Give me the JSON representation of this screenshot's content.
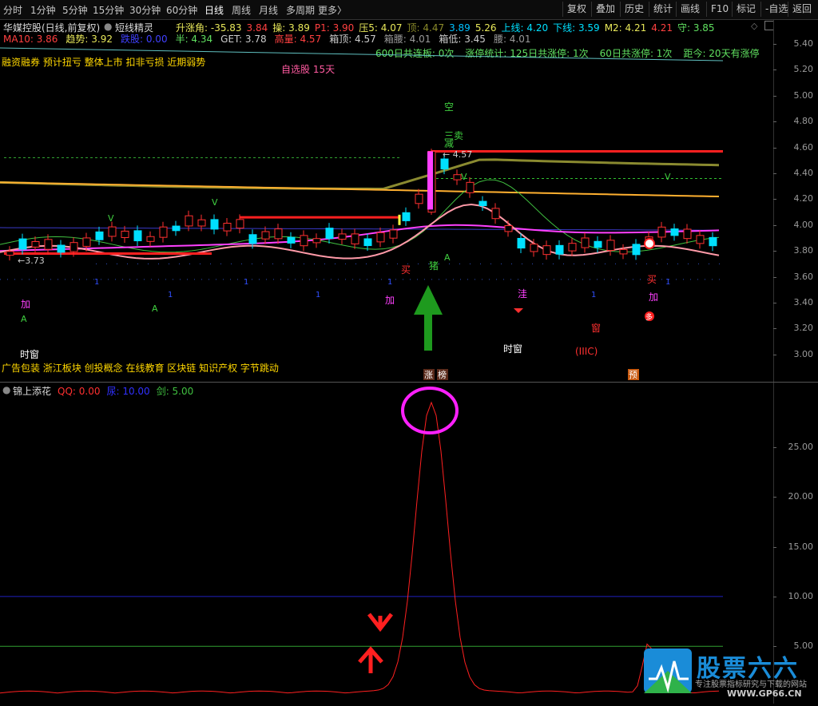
{
  "toolbar": {
    "periods": [
      "分时",
      "1分钟",
      "5分钟",
      "15分钟",
      "30分钟",
      "60分钟",
      "日线",
      "周线",
      "月线",
      "多周期",
      "更多〉"
    ],
    "active": "日线",
    "actions": [
      "复权",
      "叠加",
      "历史",
      "统计",
      "画线",
      "F10",
      "标记",
      "-自选",
      "返回"
    ]
  },
  "main": {
    "stock_title": "华媒控股(日线,前复权)",
    "indicator": "短线精灵",
    "row1": [
      {
        "t": "升涨角: -35.83",
        "c": "#e8e85a"
      },
      {
        "t": "3.84",
        "c": "#ff4040"
      },
      {
        "t": "操: 3.89",
        "c": "#e8e85a"
      },
      {
        "t": "P1: 3.90",
        "c": "#ff4040"
      },
      {
        "t": "压5: 4.07",
        "c": "#e8e85a"
      },
      {
        "t": "顶: 4.47",
        "c": "#8a8a2a"
      },
      {
        "t": "3.89",
        "c": "#00c0ff"
      },
      {
        "t": "5.26",
        "c": "#e8e85a"
      },
      {
        "t": "上线: 4.20",
        "c": "#00e0ff"
      },
      {
        "t": "下线: 3.59",
        "c": "#00e0ff"
      },
      {
        "t": "M2: 4.21",
        "c": "#e8e85a"
      },
      {
        "t": "4.21",
        "c": "#ff4040"
      },
      {
        "t": "守: 3.85",
        "c": "#60e060"
      }
    ],
    "row2": [
      {
        "t": "MA10: 3.86",
        "c": "#ff4040"
      },
      {
        "t": "趋势: 3.92",
        "c": "#e8e85a"
      },
      {
        "t": "跌股: 0.00",
        "c": "#4040ff"
      },
      {
        "t": "半: 4.34",
        "c": "#60e060"
      },
      {
        "t": "GET: 3.78",
        "c": "#cccccc"
      },
      {
        "t": "高量: 4.57",
        "c": "#ff4040"
      },
      {
        "t": "箱顶: 4.57",
        "c": "#cccccc"
      },
      {
        "t": "箱腰: 4.01",
        "c": "#9a9a9a"
      },
      {
        "t": "箱低: 3.45",
        "c": "#cccccc"
      },
      {
        "t": "腰: 4.01",
        "c": "#9a9a9a"
      }
    ],
    "row3": [
      {
        "t": "600日共连板: 0次",
        "c": "#60e060"
      },
      {
        "t": "涨停统计: 125日共涨停: 1次",
        "c": "#60e060"
      },
      {
        "t": "60日共涨停: 1次",
        "c": "#60e060"
      },
      {
        "t": "距今: 20天有涨停",
        "c": "#60e060"
      }
    ],
    "concepts": "融资融券 预计扭亏 整体上市 扣非亏损 近期弱势",
    "self_select": "自选股 15天",
    "concepts2": "广告包装 浙江板块 创投概念 在线教育 区块链 知识产权 字节跳动",
    "y_labels": [
      "5.40",
      "5.20",
      "5.00",
      "4.80",
      "4.60",
      "4.40",
      "4.20",
      "4.00",
      "3.80",
      "3.60",
      "3.40",
      "3.20",
      "3.00"
    ],
    "price_high": "4.57",
    "price_low": "3.73",
    "signals": {
      "kong": "空",
      "sanmai": "三卖",
      "jian": "减",
      "mai1": "买",
      "zhu": "猪",
      "shichuang1": "时窗",
      "shichuang2": "时窗",
      "jia": "加",
      "wa": "洼",
      "chuang": "窗",
      "iiic": "(IIIC)",
      "mai2": "买",
      "jia2": "加",
      "duo": "多",
      "v": "V",
      "a": "A",
      "zhang": "涨",
      "bang": "榜",
      "yu": "预"
    }
  },
  "sub": {
    "title": "锦上添花",
    "params": [
      {
        "t": "QQ: 0.00",
        "c": "#ff3030"
      },
      {
        "t": "尿: 10.00",
        "c": "#3030ff"
      },
      {
        "t": "剑: 5.00",
        "c": "#40c040"
      }
    ],
    "y_labels": [
      "25.00",
      "20.00",
      "15.00",
      "10.00",
      "5.00"
    ]
  },
  "watermark": {
    "brand": "股票六六",
    "tagline": "专注股票指标研究与下载的网站",
    "url": "WWW.GP66.CN"
  },
  "colors": {
    "bg": "#000000",
    "up": "#ff3030",
    "down": "#00e0ff",
    "magenta": "#ff40ff",
    "green_arrow": "#1e9a1e"
  }
}
